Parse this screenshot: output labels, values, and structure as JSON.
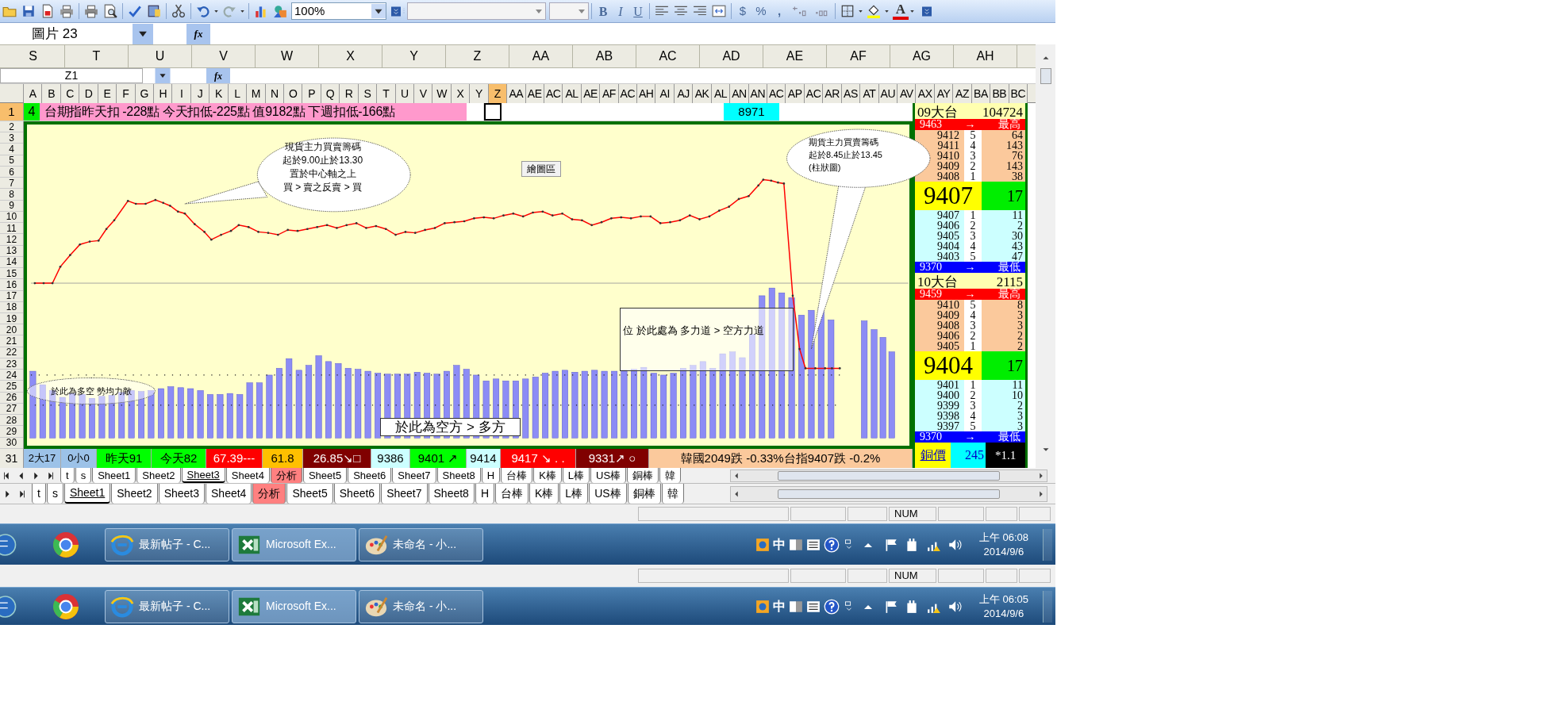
{
  "toolbar": {
    "zoom": "100%",
    "bold": "B",
    "italic": "I",
    "underline": "U",
    "currency": "$",
    "percent": "%",
    "comma": ",",
    "font_color": "A"
  },
  "name_box": {
    "value": "圖片 23",
    "fx": "fx"
  },
  "column_headers": [
    "S",
    "T",
    "U",
    "V",
    "W",
    "X",
    "Y",
    "Z",
    "AA",
    "AB",
    "AC",
    "AD",
    "AE",
    "AF",
    "AG",
    "AH"
  ],
  "inner_name_box": {
    "value": "Z1",
    "fx": "fx"
  },
  "inner_column_headers": [
    {
      "label": "A",
      "selected": false
    },
    {
      "label": "B",
      "selected": false
    },
    {
      "label": "C",
      "selected": false
    },
    {
      "label": "D",
      "selected": false
    },
    {
      "label": "E",
      "selected": false
    },
    {
      "label": "F",
      "selected": false
    },
    {
      "label": "G",
      "selected": false
    },
    {
      "label": "H",
      "selected": false
    },
    {
      "label": "I",
      "selected": false
    },
    {
      "label": "J",
      "selected": false
    },
    {
      "label": "K",
      "selected": false
    },
    {
      "label": "L",
      "selected": false
    },
    {
      "label": "M",
      "selected": false
    },
    {
      "label": "N",
      "selected": false
    },
    {
      "label": "O",
      "selected": false
    },
    {
      "label": "P",
      "selected": false
    },
    {
      "label": "Q",
      "selected": false
    },
    {
      "label": "R",
      "selected": false
    },
    {
      "label": "S",
      "selected": false
    },
    {
      "label": "T",
      "selected": false
    },
    {
      "label": "U",
      "selected": false
    },
    {
      "label": "V",
      "selected": false
    },
    {
      "label": "W",
      "selected": false
    },
    {
      "label": "X",
      "selected": false
    },
    {
      "label": "Y",
      "selected": false
    },
    {
      "label": "Z",
      "selected": true
    },
    {
      "label": "AA",
      "selected": false
    },
    {
      "label": "AE",
      "selected": false
    },
    {
      "label": "AC",
      "selected": false
    },
    {
      "label": "AL",
      "selected": false
    },
    {
      "label": "AE",
      "selected": false
    },
    {
      "label": "AF",
      "selected": false
    },
    {
      "label": "AC",
      "selected": false
    },
    {
      "label": "AH",
      "selected": false
    },
    {
      "label": "AI",
      "selected": false
    },
    {
      "label": "AJ",
      "selected": false
    },
    {
      "label": "AK",
      "selected": false
    },
    {
      "label": "AL",
      "selected": false
    },
    {
      "label": "AN",
      "selected": false
    },
    {
      "label": "AN",
      "selected": false
    },
    {
      "label": "AC",
      "selected": false
    },
    {
      "label": "AP",
      "selected": false
    },
    {
      "label": "AC",
      "selected": false
    },
    {
      "label": "AR",
      "selected": false
    },
    {
      "label": "AS",
      "selected": false
    },
    {
      "label": "AT",
      "selected": false
    },
    {
      "label": "AU",
      "selected": false
    },
    {
      "label": "AV",
      "selected": false
    },
    {
      "label": "AX",
      "selected": false
    },
    {
      "label": "AY",
      "selected": false
    },
    {
      "label": "AZ",
      "selected": false
    },
    {
      "label": "BA",
      "selected": false
    },
    {
      "label": "BB",
      "selected": false
    },
    {
      "label": "BC",
      "selected": false
    }
  ],
  "row_1": {
    "row_number": "1",
    "count": "4",
    "message": "台期指昨天扣 -228點 今天扣低-225點 值9182點 下週扣低-166點",
    "value": "8971"
  },
  "chart": {
    "row_numbers": [
      "2",
      "3",
      "4",
      "5",
      "6",
      "7",
      "8",
      "9",
      "10",
      "11",
      "12",
      "13",
      "14",
      "15",
      "16",
      "17",
      "18",
      "19",
      "20",
      "21",
      "22",
      "23",
      "24",
      "25",
      "26",
      "27",
      "28",
      "29",
      "30"
    ],
    "plot_area_label": "繪圖區",
    "callouts": [
      {
        "kind": "bubble",
        "lines": [
          "現貨主力買賣籌碼",
          "起於9.00止於13.30",
          "置於中心軸之上",
          "買 > 賣之反賣 > 買"
        ]
      },
      {
        "kind": "bubble",
        "lines": [
          "期貨主力買賣籌碼",
          "起於8.45止於13.45",
          "(柱狀圖)"
        ]
      },
      {
        "kind": "box",
        "lines": [
          "位 於此處為  多力道 > 空方力道"
        ]
      },
      {
        "kind": "ellipse",
        "lines": [
          "於此為多空  勢均力敵"
        ]
      },
      {
        "kind": "box",
        "lines": [
          "於此為空方 > 多方"
        ]
      }
    ]
  },
  "quote_panel": {
    "blocks": [
      {
        "title": "09大台",
        "volume": "104724",
        "high": {
          "price": "9463",
          "arrow": "→",
          "label": "最高"
        },
        "asks": [
          {
            "price": "9412",
            "count": "5",
            "qty": "64"
          },
          {
            "price": "9411",
            "count": "4",
            "qty": "143"
          },
          {
            "price": "9410",
            "count": "3",
            "qty": "76"
          },
          {
            "price": "9409",
            "count": "2",
            "qty": "143"
          },
          {
            "price": "9408",
            "count": "1",
            "qty": "38"
          }
        ],
        "last": {
          "price": "9407",
          "qty": "17"
        },
        "bids": [
          {
            "price": "9407",
            "count": "1",
            "qty": "11"
          },
          {
            "price": "9406",
            "count": "2",
            "qty": "2"
          },
          {
            "price": "9405",
            "count": "3",
            "qty": "30"
          },
          {
            "price": "9404",
            "count": "4",
            "qty": "43"
          },
          {
            "price": "9403",
            "count": "5",
            "qty": "47"
          }
        ],
        "low": {
          "price": "9370",
          "arrow": "→",
          "label": "最低"
        }
      },
      {
        "title": "10大台",
        "volume": "2115",
        "high": {
          "price": "9459",
          "arrow": "→",
          "label": "最高"
        },
        "asks": [
          {
            "price": "9410",
            "count": "5",
            "qty": "8"
          },
          {
            "price": "9409",
            "count": "4",
            "qty": "3"
          },
          {
            "price": "9408",
            "count": "3",
            "qty": "3"
          },
          {
            "price": "9406",
            "count": "2",
            "qty": "2"
          },
          {
            "price": "9405",
            "count": "1",
            "qty": "2"
          }
        ],
        "last": {
          "price": "9404",
          "qty": "17"
        },
        "bids": [
          {
            "price": "9401",
            "count": "1",
            "qty": "11"
          },
          {
            "price": "9400",
            "count": "2",
            "qty": "10"
          },
          {
            "price": "9399",
            "count": "3",
            "qty": "2"
          },
          {
            "price": "9398",
            "count": "4",
            "qty": "3"
          },
          {
            "price": "9397",
            "count": "5",
            "qty": "3"
          }
        ],
        "low": {
          "price": "9370",
          "arrow": "→",
          "label": "最低"
        }
      }
    ],
    "footer": {
      "label": "銅價",
      "value": "245",
      "ratio": "*1.1"
    }
  },
  "status_row": {
    "row_number": "31",
    "cells": [
      {
        "text": "2大17",
        "color": "#9cc2e8",
        "kind": "light"
      },
      {
        "text": "0小0",
        "color": "#9cc2e8",
        "kind": "light"
      },
      {
        "text": "昨天91",
        "color": "#00ff00",
        "kind": "light"
      },
      {
        "text": "今天82",
        "color": "#00ff00",
        "kind": "light"
      },
      {
        "text": "67.39---",
        "color": "#ff0000",
        "kind": "dark"
      },
      {
        "text": "61.8",
        "color": "#ffc000",
        "kind": "light"
      },
      {
        "text": "26.85↘□",
        "color": "#800000",
        "kind": "dark"
      },
      {
        "text": "9386",
        "color": "#ccffff",
        "kind": "light"
      },
      {
        "text": "9401 ↗",
        "color": "#00ff00",
        "kind": "light"
      },
      {
        "text": "9414",
        "color": "#ccffff",
        "kind": "light"
      },
      {
        "text": "9417 ↘ . .",
        "color": "#ff0000",
        "kind": "dark"
      },
      {
        "text": "9331↗ ○",
        "color": "#800000",
        "kind": "dark"
      },
      {
        "text": "韓國2049跌 -0.33%台指9407跌 -0.2%",
        "color": "#fbc99c",
        "kind": "light"
      }
    ]
  },
  "sheet_tabs": [
    {
      "tabs": [
        {
          "label": "t",
          "selected": false,
          "color": "#ffffff"
        },
        {
          "label": "s",
          "selected": false,
          "color": "#ffffff"
        },
        {
          "label": "Sheet1",
          "selected": false,
          "color": "#ffffff"
        },
        {
          "label": "Sheet2",
          "selected": false,
          "color": "#ffffff"
        },
        {
          "label": "Sheet3",
          "selected": true,
          "color": "#ffffff"
        },
        {
          "label": "Sheet4",
          "selected": false,
          "color": "#ffffff"
        },
        {
          "label": "分析",
          "selected": false,
          "color": "#ff8080"
        },
        {
          "label": "Sheet5",
          "selected": false,
          "color": "#ffffff"
        },
        {
          "label": "Sheet6",
          "selected": false,
          "color": "#ffffff"
        },
        {
          "label": "Sheet7",
          "selected": false,
          "color": "#ffffff"
        },
        {
          "label": "Sheet8",
          "selected": false,
          "color": "#ffffff"
        },
        {
          "label": "H",
          "selected": false,
          "color": "#ffffff"
        },
        {
          "label": "台棒",
          "selected": false,
          "color": "#ffffff"
        },
        {
          "label": "K棒",
          "selected": false,
          "color": "#ffffff"
        },
        {
          "label": "L棒",
          "selected": false,
          "color": "#ffffff"
        },
        {
          "label": "US棒",
          "selected": false,
          "color": "#ffffff"
        },
        {
          "label": "銅棒",
          "selected": false,
          "color": "#ffffff"
        },
        {
          "label": "韓",
          "selected": false,
          "color": "#ffffff"
        }
      ]
    },
    {
      "tabs": [
        {
          "label": "t",
          "selected": false,
          "color": "#ffffff"
        },
        {
          "label": "s",
          "selected": false,
          "color": "#ffffff"
        },
        {
          "label": "Sheet1",
          "selected": true,
          "color": "#ffffff"
        },
        {
          "label": "Sheet2",
          "selected": false,
          "color": "#ffffff"
        },
        {
          "label": "Sheet3",
          "selected": false,
          "color": "#ffffff"
        },
        {
          "label": "Sheet4",
          "selected": false,
          "color": "#ffffff"
        },
        {
          "label": "分析",
          "selected": false,
          "color": "#ff8080"
        },
        {
          "label": "Sheet5",
          "selected": false,
          "color": "#ffffff"
        },
        {
          "label": "Sheet6",
          "selected": false,
          "color": "#ffffff"
        },
        {
          "label": "Sheet7",
          "selected": false,
          "color": "#ffffff"
        },
        {
          "label": "Sheet8",
          "selected": false,
          "color": "#ffffff"
        },
        {
          "label": "H",
          "selected": false,
          "color": "#ffffff"
        },
        {
          "label": "台棒",
          "selected": false,
          "color": "#ffffff"
        },
        {
          "label": "K棒",
          "selected": false,
          "color": "#ffffff"
        },
        {
          "label": "L棒",
          "selected": false,
          "color": "#ffffff"
        },
        {
          "label": "US棒",
          "selected": false,
          "color": "#ffffff"
        },
        {
          "label": "銅棒",
          "selected": false,
          "color": "#ffffff"
        },
        {
          "label": "韓",
          "selected": false,
          "color": "#ffffff"
        }
      ]
    }
  ],
  "status_bars": [
    {
      "indicator": "NUM"
    },
    {
      "indicator": "NUM"
    }
  ],
  "taskbars": [
    {
      "buttons": [
        {
          "kind": "browser",
          "label": "最新帖子 - C...",
          "selected": false
        },
        {
          "kind": "spreadsheet",
          "label": "Microsoft Ex...",
          "selected": true
        },
        {
          "kind": "paint",
          "label": "未命名 - 小...",
          "selected": false
        }
      ],
      "ime": "中",
      "time": "上午 06:08",
      "date": "2014/9/6"
    },
    {
      "buttons": [
        {
          "kind": "browser",
          "label": "最新帖子 - C...",
          "selected": false
        },
        {
          "kind": "spreadsheet",
          "label": "Microsoft Ex...",
          "selected": true
        },
        {
          "kind": "paint",
          "label": "未命名 - 小...",
          "selected": false
        }
      ],
      "ime": "中",
      "time": "上午 06:05",
      "date": "2014/9/6"
    }
  ]
}
